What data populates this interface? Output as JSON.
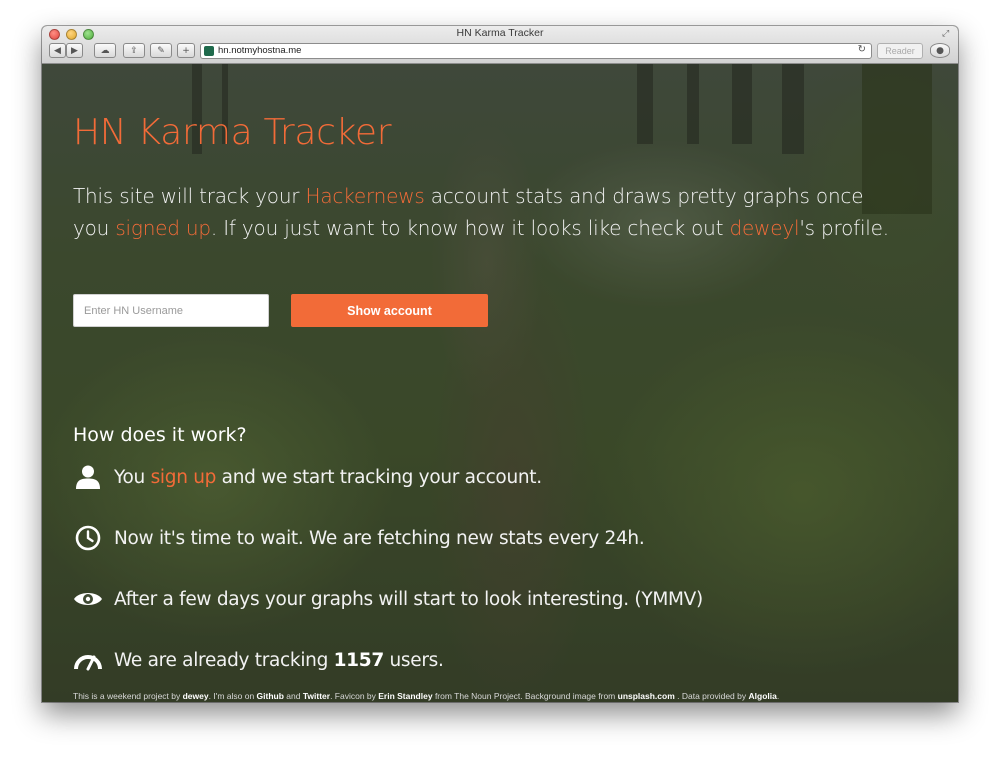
{
  "window": {
    "title": "HN Karma Tracker",
    "url": "hn.notmyhostna.me",
    "reader_label": "Reader"
  },
  "toolbar_icons": [
    "back-icon",
    "forward-icon",
    "icloud-icon",
    "share-icon",
    "tools-icon",
    "add-tab-icon",
    "reload-icon",
    "downloads-icon"
  ],
  "page": {
    "title": "HN Karma Tracker",
    "intro": {
      "t1": "This site will track your ",
      "link_hackernews": "Hackernews",
      "t2": " account stats and draws pretty graphs once you ",
      "link_signed_up": "signed up",
      "t3": ". If you just want to know how it looks like check out ",
      "link_deweyl": "deweyl",
      "t4": "'s profile."
    },
    "username_placeholder": "Enter HN Username",
    "show_button": "Show account",
    "how_title": "How does it work?",
    "steps": [
      {
        "icon": "user-icon",
        "pre": "You ",
        "link": "sign up",
        "post": " and we start tracking your account."
      },
      {
        "icon": "clock-icon",
        "text": "Now it's time to wait. We are fetching new stats every 24h."
      },
      {
        "icon": "eye-icon",
        "text": "After a few days your graphs will start to look interesting. (YMMV)"
      },
      {
        "icon": "speedometer-icon",
        "pre": "We are already tracking ",
        "count": "1157",
        "post": " users."
      }
    ],
    "footer": {
      "f1": "This is a weekend project by ",
      "dewey": "dewey",
      "f2": ". I'm also on ",
      "github": "Github",
      "f3": " and ",
      "twitter": "Twitter",
      "f4": ". Favicon by ",
      "erin": "Erin Standley",
      "f5": " from The Noun Project. Background image from ",
      "unsplash": "unsplash.com",
      "f6": " . Data provided by ",
      "algolia": "Algolia",
      "f7": "."
    }
  },
  "colors": {
    "accent": "#f26b38",
    "text": "#f2f2f2"
  }
}
